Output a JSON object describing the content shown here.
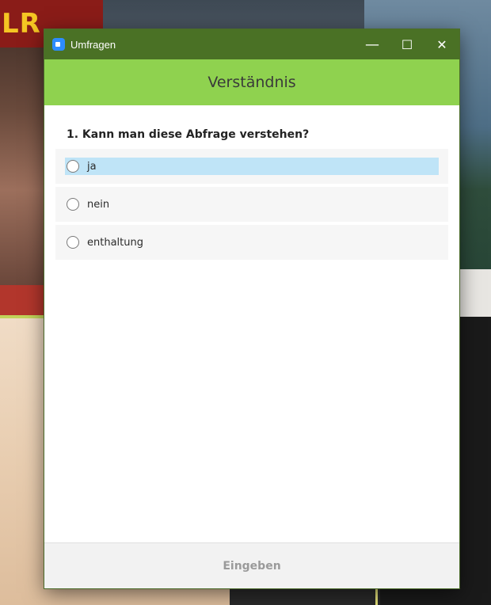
{
  "window": {
    "title": "Umfragen",
    "controls": {
      "minimize": "—",
      "maximize": "☐",
      "close": "✕"
    }
  },
  "poll": {
    "heading": "Verständnis",
    "question": "1. Kann man diese Abfrage verstehen?",
    "options": [
      {
        "label": "ja",
        "highlighted": true,
        "selected": false
      },
      {
        "label": "nein",
        "highlighted": false,
        "selected": false
      },
      {
        "label": "enthaltung",
        "highlighted": false,
        "selected": false
      }
    ],
    "submit_label": "Eingeben"
  },
  "background": {
    "logo_text": "LR"
  },
  "colors": {
    "titlebar": "#4a7125",
    "header": "#8fd24f",
    "highlight": "#bfe4f7",
    "app_icon": "#2d8cff"
  },
  "icons": {
    "app": "zoom-camera-icon",
    "radio": "radio-unchecked-icon"
  }
}
